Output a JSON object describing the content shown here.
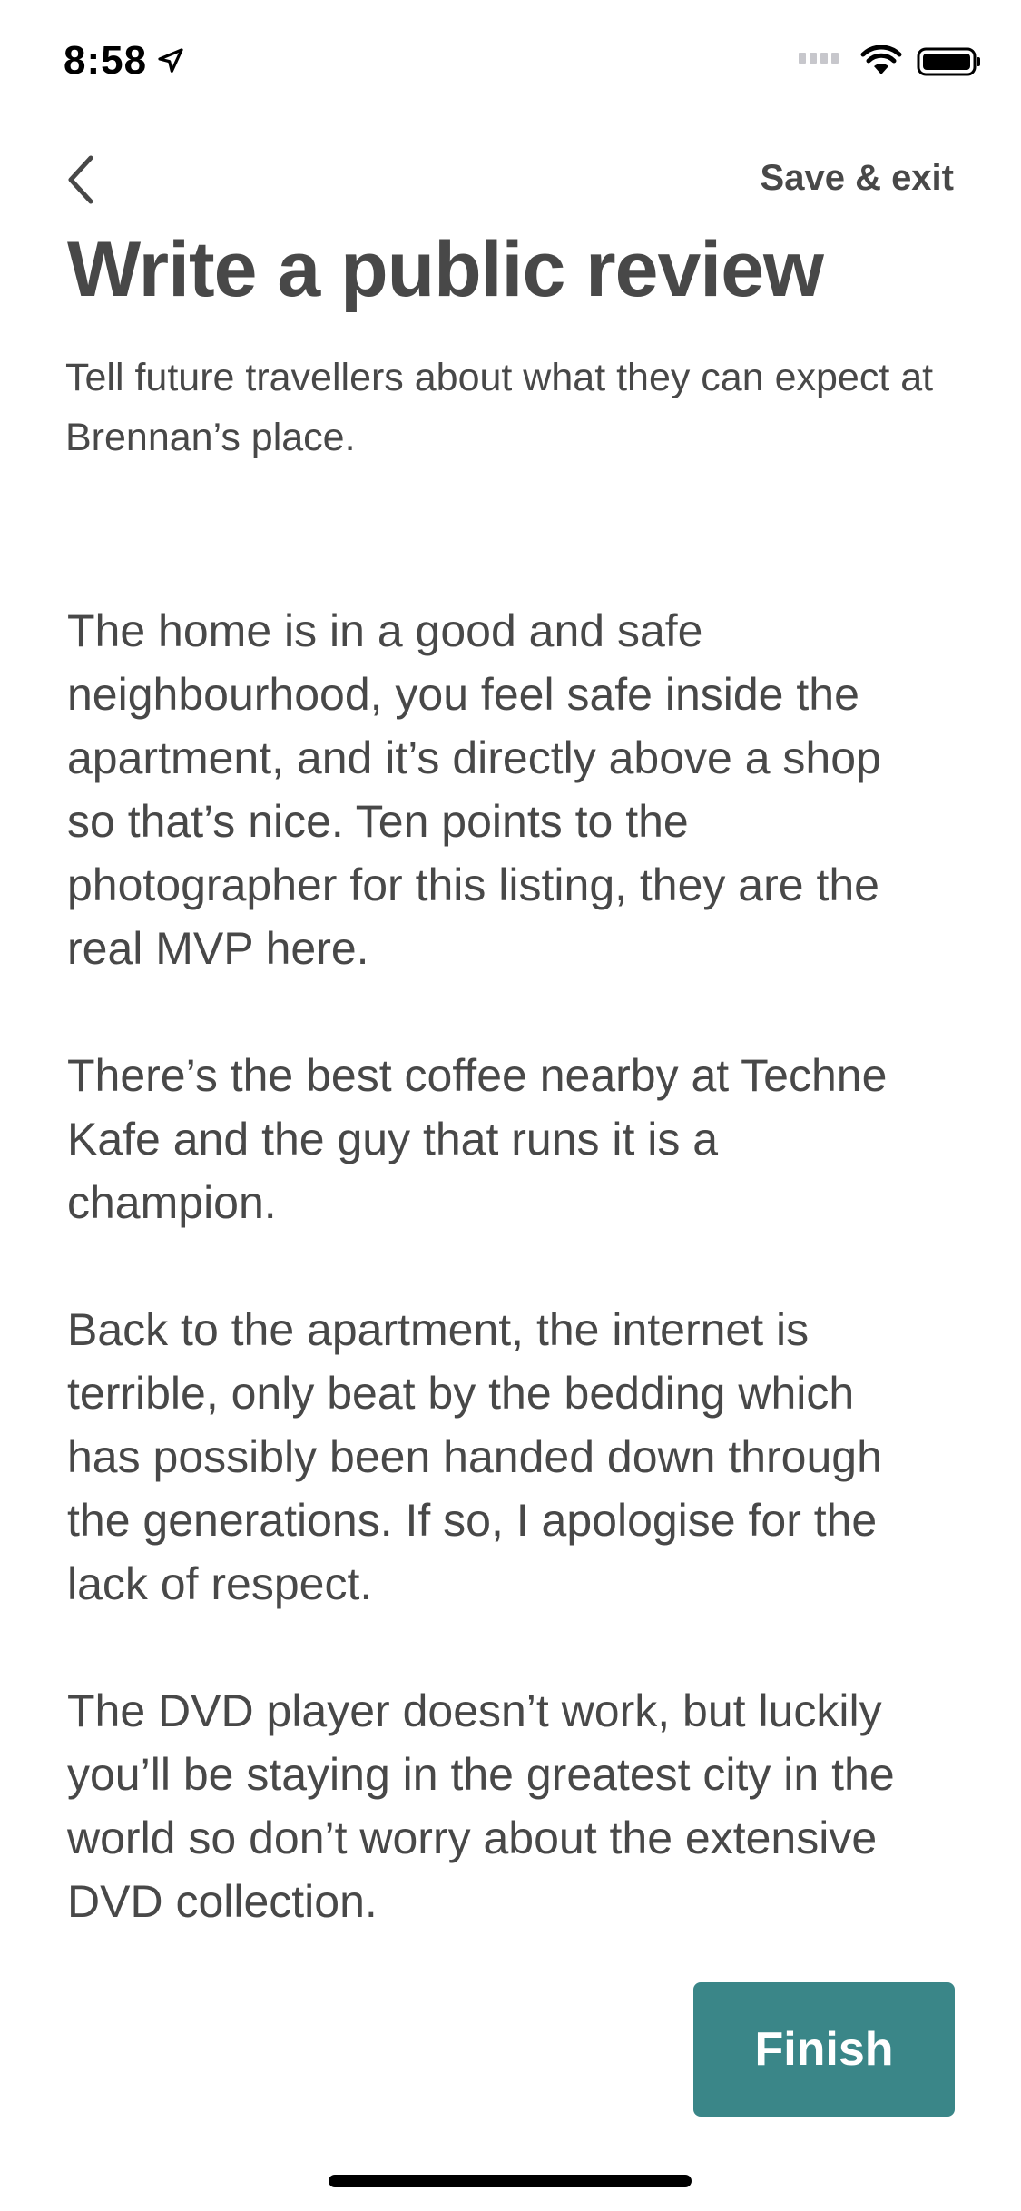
{
  "status_bar": {
    "time": "8:58",
    "icons": [
      "location-arrow-icon",
      "cellular-signal-icon",
      "wifi-icon",
      "battery-icon"
    ]
  },
  "header": {
    "back_icon": "chevron-left-icon",
    "save_exit_label": "Save & exit"
  },
  "main": {
    "title": "Write a public review",
    "subtitle": "Tell future travellers about what they can expect at Brennan’s place.",
    "review_paragraphs": [
      "The home is in a good and safe neighbourhood, you feel safe inside the apartment, and it’s directly above a shop so that’s nice. Ten points to the photographer for this listing, they are the real MVP here.",
      "There’s the best coffee nearby at Techne Kafe and the guy that runs it is a champion.",
      "Back to the apartment, the internet is terrible, only beat by the bedding which has possibly been handed down through the generations. If so, I apologise for the lack of respect.",
      "The DVD player doesn’t work, but luckily you’ll be staying in the greatest city in the world so don’t worry about the extensive DVD collection."
    ]
  },
  "footer": {
    "finish_label": "Finish"
  },
  "colors": {
    "text": "#484848",
    "accent": "#3a8688",
    "background": "#ffffff"
  }
}
